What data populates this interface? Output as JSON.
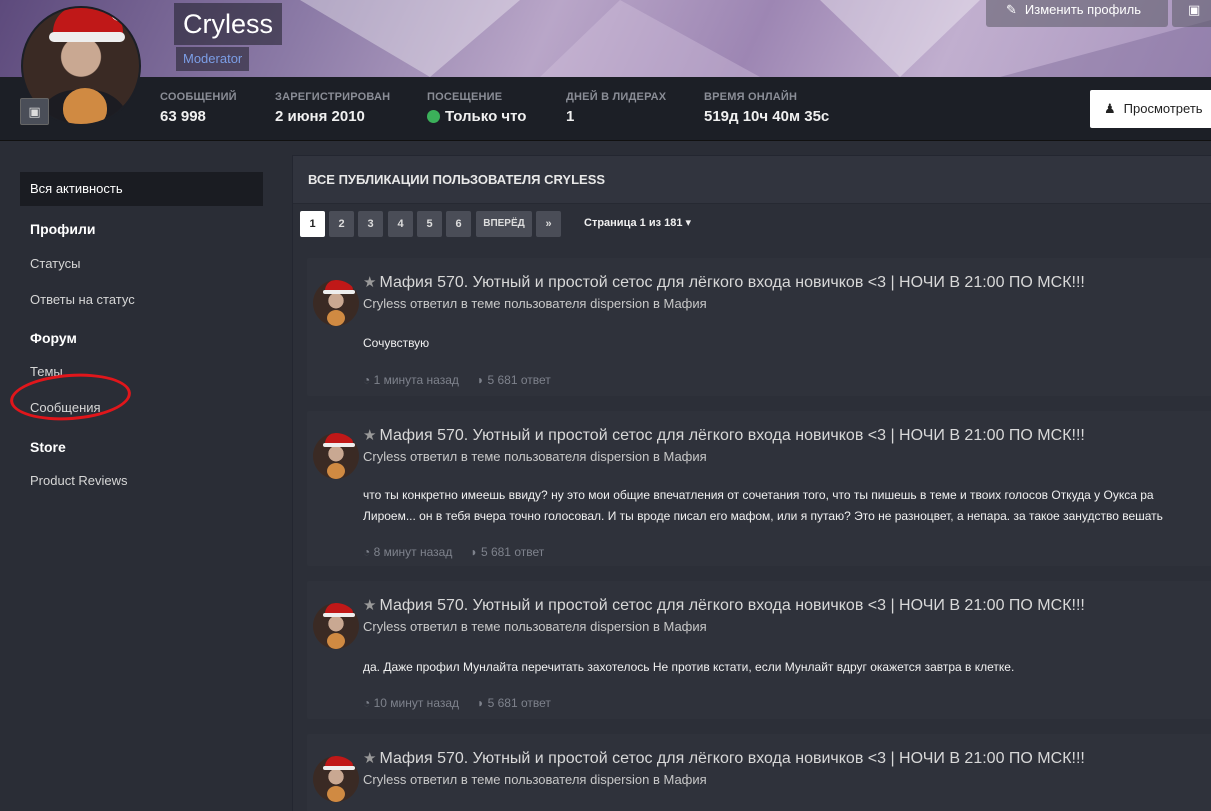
{
  "profile": {
    "name": "Cryless",
    "role": "Moderator",
    "edit_button": "Изменить профиль",
    "view_button": "Просмотреть"
  },
  "stats": [
    {
      "label": "СООБЩЕНИЙ",
      "value": "63 998"
    },
    {
      "label": "ЗАРЕГИСТРИРОВАН",
      "value": "2 июня 2010"
    },
    {
      "label": "ПОСЕЩЕНИЕ",
      "value": "Только что",
      "online": true
    },
    {
      "label": "ДНЕЙ В ЛИДЕРАХ",
      "value": "1"
    },
    {
      "label": "ВРЕМЯ ОНЛАЙН",
      "value": "519д 10ч 40м 35с"
    }
  ],
  "sidebar": {
    "active": "Вся активность",
    "groups": [
      {
        "heading": "Профили",
        "items": [
          "Статусы",
          "Ответы на статус"
        ]
      },
      {
        "heading": "Форум",
        "items": [
          "Темы",
          "Сообщения"
        ]
      },
      {
        "heading": "Store",
        "items": [
          "Product Reviews"
        ]
      }
    ]
  },
  "main": {
    "heading": "ВСЕ ПУБЛИКАЦИИ ПОЛЬЗОВАТЕЛЯ CRYLESS",
    "pagination": {
      "pages": [
        "1",
        "2",
        "3",
        "4",
        "5",
        "6"
      ],
      "current": "1",
      "next_label": "ВПЕРЁД",
      "last_label": "»",
      "info": "Страница 1 из 181"
    },
    "posts": [
      {
        "title": "Мафия 570. Уютный и простой сетос для лёгкого входа новичков <3 | НОЧИ В 21:00 ПО МСК!!!",
        "subtitle": "Cryless ответил в теме пользователя dispersion в Мафия",
        "body": [
          "Сочувствую"
        ],
        "time": "1 минута назад",
        "replies": "5 681 ответ"
      },
      {
        "title": "Мафия 570. Уютный и простой сетос для лёгкого входа новичков <3 | НОЧИ В 21:00 ПО МСК!!!",
        "subtitle": "Cryless ответил в теме пользователя dispersion в Мафия",
        "body": [
          "что ты конкретно имеешь ввиду? ну это мои общие впечатления от сочетания того, что ты пишешь в теме и твоих голосов Откуда у Оукса ра",
          "Лироем... он в тебя вчера точно голосовал. И ты вроде писал его мафом, или я путаю? Это не разноцвет, а непара. за такое занудство вешать"
        ],
        "time": "8 минут назад",
        "replies": "5 681 ответ"
      },
      {
        "title": "Мафия 570. Уютный и простой сетос для лёгкого входа новичков <3 | НОЧИ В 21:00 ПО МСК!!!",
        "subtitle": "Cryless ответил в теме пользователя dispersion в Мафия",
        "body": [
          "да. Даже профил Мунлайта перечитать захотелось Не против кстати, если Мунлайт вдруг окажется завтра в клетке."
        ],
        "time": "10 минут назад",
        "replies": "5 681 ответ"
      },
      {
        "title": "Мафия 570. Уютный и простой сетос для лёгкого входа новичков <3 | НОЧИ В 21:00 ПО МСК!!!",
        "subtitle": "Cryless ответил в теме пользователя dispersion в Мафия",
        "body": [],
        "time": "",
        "replies": ""
      }
    ]
  },
  "icons": {
    "edit": "pencil-icon",
    "cover_photo": "image-icon",
    "view": "user-icon",
    "star": "star-icon",
    "clock": "clock-icon",
    "comment": "comment-icon"
  }
}
